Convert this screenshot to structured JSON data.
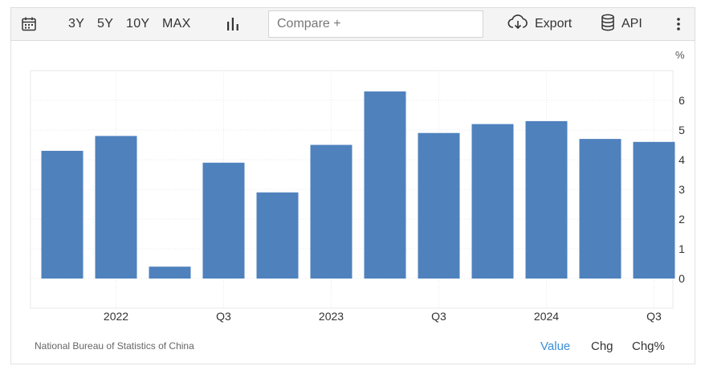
{
  "toolbar": {
    "ranges": [
      "3Y",
      "5Y",
      "10Y",
      "MAX"
    ],
    "compare_placeholder": "Compare +",
    "export_label": "Export",
    "api_label": "API",
    "icons": {
      "calendar": "calendar-icon",
      "chart_type": "bar-chart-icon",
      "export": "cloud-download-icon",
      "api": "database-icon",
      "more": "more-vertical-icon"
    }
  },
  "unit_label": "%",
  "source": "National Bureau of Statistics of China",
  "modes": {
    "value": "Value",
    "chg": "Chg",
    "chg_pct": "Chg%",
    "active": "Value"
  },
  "colors": {
    "bar": "#4f81bd",
    "active_mode": "#3a8fd6"
  },
  "chart_data": {
    "type": "bar",
    "x": [
      "2021 Q4",
      "2022 Q1",
      "2022 Q2",
      "2022 Q3",
      "2022 Q4",
      "2023 Q1",
      "2023 Q2",
      "2023 Q3",
      "2023 Q4",
      "2024 Q1",
      "2024 Q2",
      "2024 Q3"
    ],
    "values": [
      4.3,
      4.8,
      0.4,
      3.9,
      2.9,
      4.5,
      6.3,
      4.9,
      5.2,
      5.3,
      4.7,
      4.6
    ],
    "x_tick_labels": [
      {
        "label": "2022",
        "at": 1.5
      },
      {
        "label": "Q3",
        "at": 3.5
      },
      {
        "label": "2023",
        "at": 5.5
      },
      {
        "label": "Q3",
        "at": 7.5
      },
      {
        "label": "2024",
        "at": 9.5
      },
      {
        "label": "Q3",
        "at": 11.5
      }
    ],
    "y_ticks": [
      0,
      1,
      2,
      3,
      4,
      5,
      6
    ],
    "ylim": [
      -1,
      7
    ],
    "ylabel": "%",
    "title": "",
    "xlabel": "",
    "grid": true,
    "y_axis_side": "right"
  }
}
